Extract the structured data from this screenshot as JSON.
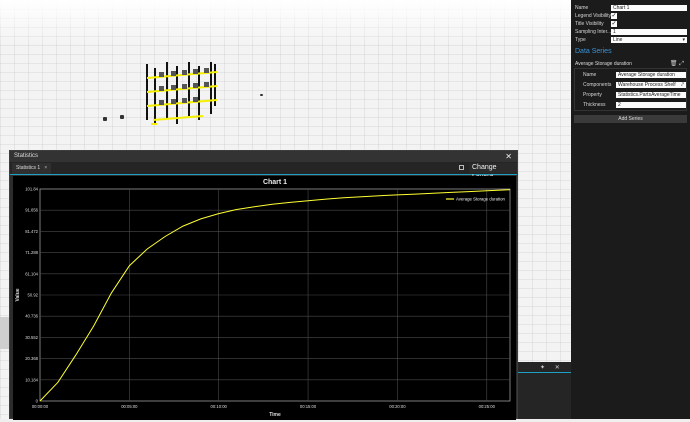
{
  "properties": {
    "name_label": "Name",
    "name_value": "Chart 1",
    "legend_label": "Legend Visibility",
    "title_vis_label": "Title Visibility",
    "sampling_label": "Sampling Inter...",
    "sampling_value": "1",
    "type_label": "Type",
    "type_value": "Line",
    "data_series_heading": "Data Series",
    "series_name": "Average Storage duration",
    "series": {
      "name_label": "Name",
      "name_value": "Average Storage duration",
      "components_label": "Components",
      "components_value": "Warehouse Process Shelf",
      "property_label": "Property",
      "property_value": "Statistics.PartsAverageTime",
      "thickness_label": "Thickness",
      "thickness_value": "2"
    },
    "add_series_label": "Add Series"
  },
  "stats_window": {
    "title": "Statistics",
    "tab_label": "Statistics 1",
    "change_layout_label": "Change Layout"
  },
  "colors": {
    "line": "#ffff33",
    "accent": "#1ea0c5",
    "heading": "#3c93d4"
  },
  "chart_data": {
    "type": "line",
    "title": "Chart 1",
    "xlabel": "Time",
    "ylabel": "Value",
    "x_ticks": [
      "00:00:00",
      "00:05:00",
      "00:10:00",
      "00:15:00",
      "00:20:00",
      "00:25:00"
    ],
    "y_ticks": [
      "0",
      "10.184",
      "20.368",
      "30.552",
      "40.736",
      "50.92",
      "61.104",
      "71.288",
      "81.472",
      "91.656",
      "101.84"
    ],
    "xlim_minutes": [
      0,
      26.3
    ],
    "ylim": [
      0,
      101.84
    ],
    "grid": true,
    "legend_position": "top-right",
    "series": [
      {
        "name": "Average Storage duration",
        "x_minutes": [
          0,
          1,
          2,
          3,
          4,
          5,
          6,
          7,
          8,
          9,
          10,
          11,
          12,
          13,
          14,
          15,
          16,
          17,
          18,
          19,
          20,
          21,
          22,
          23,
          24,
          25,
          26.3
        ],
        "values": [
          0,
          9,
          22,
          36,
          52,
          65,
          73,
          79,
          84,
          87.5,
          90,
          92,
          93.3,
          94.5,
          95.4,
          96.2,
          97,
          97.6,
          98.1,
          98.6,
          99,
          99.4,
          99.8,
          100.2,
          100.6,
          101,
          101.5
        ]
      }
    ]
  }
}
